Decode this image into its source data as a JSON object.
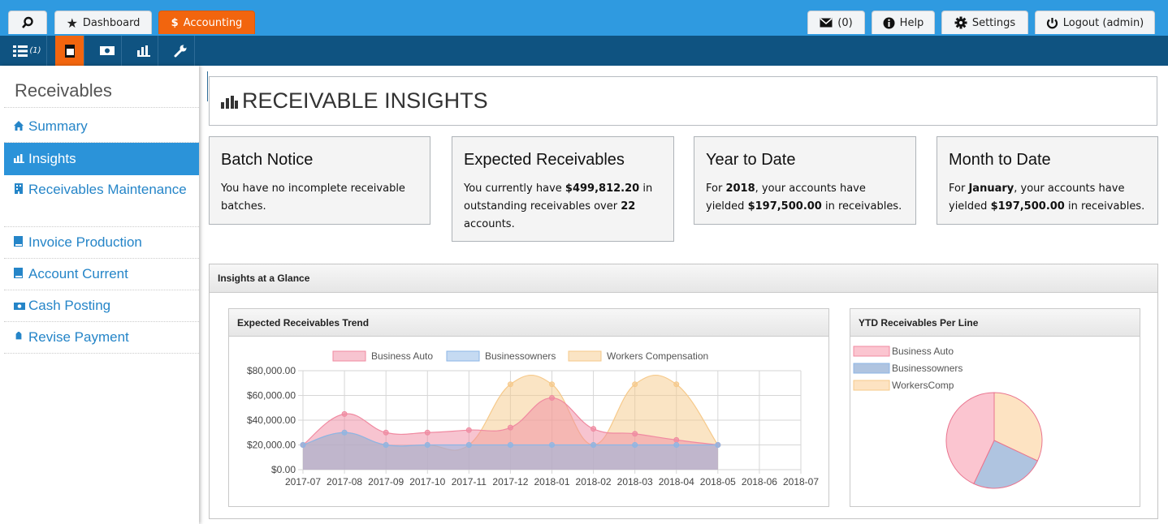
{
  "topnav": {
    "dashboard": "Dashboard",
    "accounting": "Accounting",
    "messages": "(0)",
    "help": "Help",
    "settings": "Settings",
    "logout": "Logout (admin)",
    "list_badge": "(1)"
  },
  "sidebar": {
    "title": "Receivables",
    "items": [
      {
        "label": "Summary",
        "icon": "home-icon"
      },
      {
        "label": "Insights",
        "icon": "bar-chart-icon"
      },
      {
        "label": "Receivables Maintenance",
        "icon": "building-icon"
      },
      {
        "label": "Invoice Production",
        "icon": "document-icon"
      },
      {
        "label": "Account Current",
        "icon": "document-icon"
      },
      {
        "label": "Cash Posting",
        "icon": "money-icon"
      },
      {
        "label": "Revise Payment",
        "icon": "tag-icon"
      }
    ]
  },
  "page": {
    "title": "RECEIVABLE INSIGHTS"
  },
  "cards": {
    "batch": {
      "title": "Batch Notice",
      "text": "You have no incomplete receivable batches."
    },
    "expected": {
      "title": "Expected Receivables",
      "pre": "You currently have ",
      "amount": "$499,812.20",
      "mid": " in outstanding receivables over ",
      "count": "22",
      "post": " accounts."
    },
    "ytd": {
      "title": "Year to Date",
      "pre": "For ",
      "year": "2018",
      "mid": ", your accounts have yielded ",
      "amount": "$197,500.00",
      "post": " in receivables."
    },
    "mtd": {
      "title": "Month to Date",
      "pre": "For ",
      "month": "January",
      "mid": ", your accounts have yielded ",
      "amount": "$197,500.00",
      "post": " in receivables."
    }
  },
  "glance": {
    "title": "Insights at a Glance"
  },
  "colors": {
    "accent": "#f2650e",
    "topbar": "#2f9ae0",
    "subbar": "#0f5381",
    "link": "#2585c8"
  },
  "chart_data": [
    {
      "type": "area",
      "title": "Expected Receivables Trend",
      "categories": [
        "2017-07",
        "2017-08",
        "2017-09",
        "2017-10",
        "2017-11",
        "2017-12",
        "2018-01",
        "2018-02",
        "2018-03",
        "2018-04",
        "2018-05",
        "2018-06",
        "2018-07"
      ],
      "ylim": [
        0,
        80000
      ],
      "yticks": [
        "$0.00",
        "$20,000.00",
        "$40,000.00",
        "$60,000.00",
        "$80,000.00"
      ],
      "series": [
        {
          "name": "Business Auto",
          "color": "#f08aa1",
          "values": [
            20000,
            45000,
            30000,
            30000,
            32000,
            34000,
            58000,
            33000,
            29000,
            24000,
            20000
          ]
        },
        {
          "name": "Businessowners",
          "color": "#8cb6e6",
          "values": [
            20000,
            30000,
            20000,
            20000,
            20000,
            20000,
            20000,
            20000,
            20000,
            20000,
            20000
          ]
        },
        {
          "name": "Workers Compensation",
          "color": "#f6c98a",
          "values": [
            20000,
            30000,
            20000,
            20000,
            20000,
            69000,
            69000,
            20000,
            69000,
            69000,
            20000
          ]
        }
      ],
      "grid": true,
      "legend": "top"
    },
    {
      "type": "pie",
      "title": "YTD Receivables Per Line",
      "labels": [
        "Business Auto",
        "Businessowners",
        "WorkersComp"
      ],
      "colors": [
        "#fbc5d0",
        "#afc4e0",
        "#fde3c2"
      ],
      "values": [
        43,
        25,
        32
      ],
      "legend": "top-left"
    }
  ]
}
